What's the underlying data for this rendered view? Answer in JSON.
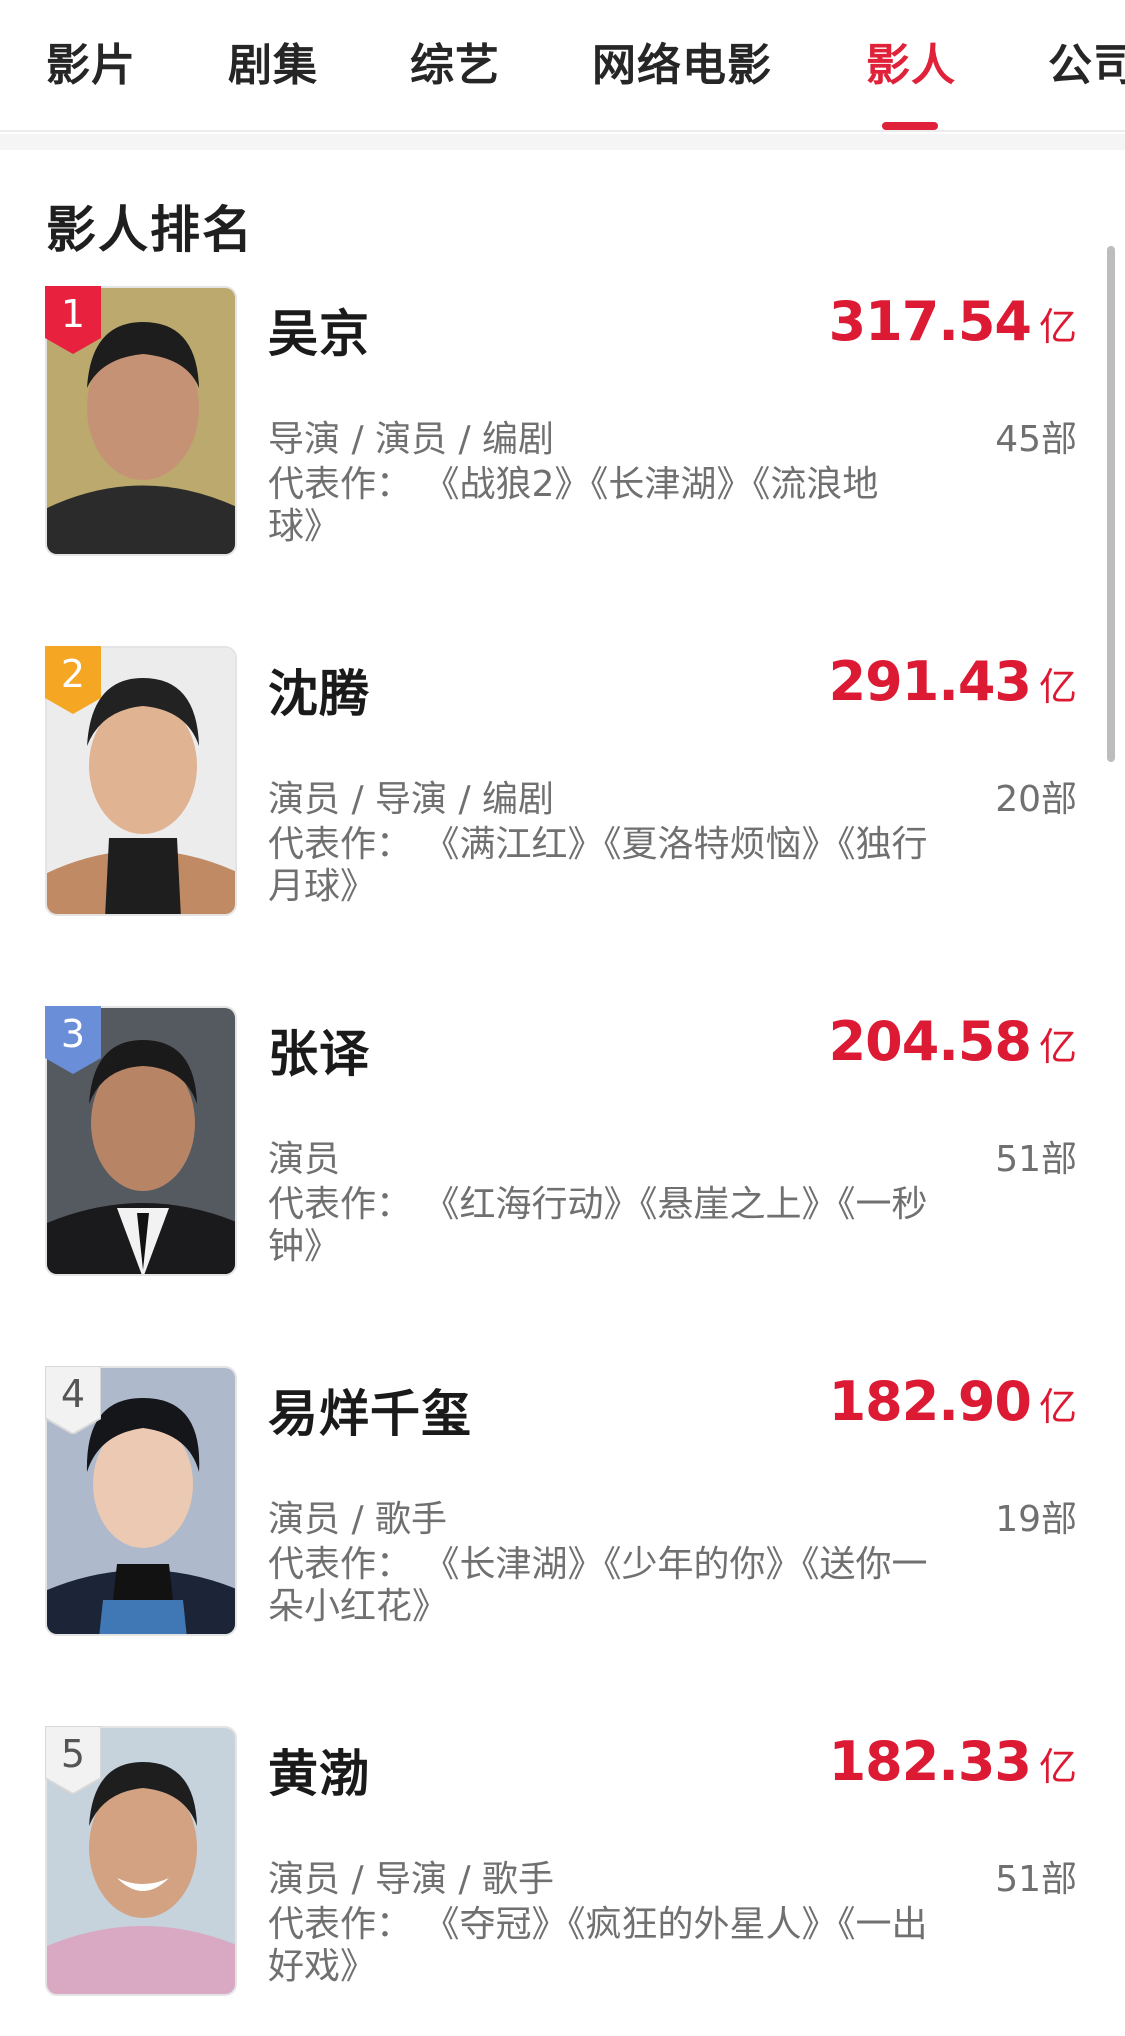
{
  "tabs": [
    {
      "label": "影片",
      "active": false
    },
    {
      "label": "剧集",
      "active": false
    },
    {
      "label": "综艺",
      "active": false
    },
    {
      "label": "网络电影",
      "active": false
    },
    {
      "label": "影人",
      "active": true
    },
    {
      "label": "公司",
      "active": false
    }
  ],
  "section_title": "影人排名",
  "colors": {
    "accent": "#e0213a",
    "badge_gold": "#e8213f",
    "badge_orange": "#f5a623",
    "badge_blue": "#6a8fd8",
    "badge_plain": "#f2f2f2"
  },
  "people": [
    {
      "rank": "1",
      "name": "吴京",
      "box_office": "317.54",
      "unit": "亿",
      "roles": "导演 / 演员 / 编剧",
      "works_count": "45部",
      "representative": "代表作： 《战狼2》《长津湖》《流浪地球》"
    },
    {
      "rank": "2",
      "name": "沈腾",
      "box_office": "291.43",
      "unit": "亿",
      "roles": "演员 / 导演 / 编剧",
      "works_count": "20部",
      "representative": "代表作： 《满江红》《夏洛特烦恼》《独行月球》"
    },
    {
      "rank": "3",
      "name": "张译",
      "box_office": "204.58",
      "unit": "亿",
      "roles": "演员",
      "works_count": "51部",
      "representative": "代表作： 《红海行动》《悬崖之上》《一秒钟》"
    },
    {
      "rank": "4",
      "name": "易烊千玺",
      "box_office": "182.90",
      "unit": "亿",
      "roles": "演员 / 歌手",
      "works_count": "19部",
      "representative": "代表作： 《长津湖》《少年的你》《送你一朵小红花》"
    },
    {
      "rank": "5",
      "name": "黄渤",
      "box_office": "182.33",
      "unit": "亿",
      "roles": "演员 / 导演 / 歌手",
      "works_count": "51部",
      "representative": "代表作： 《夺冠》《疯狂的外星人》《一出好戏》"
    }
  ]
}
